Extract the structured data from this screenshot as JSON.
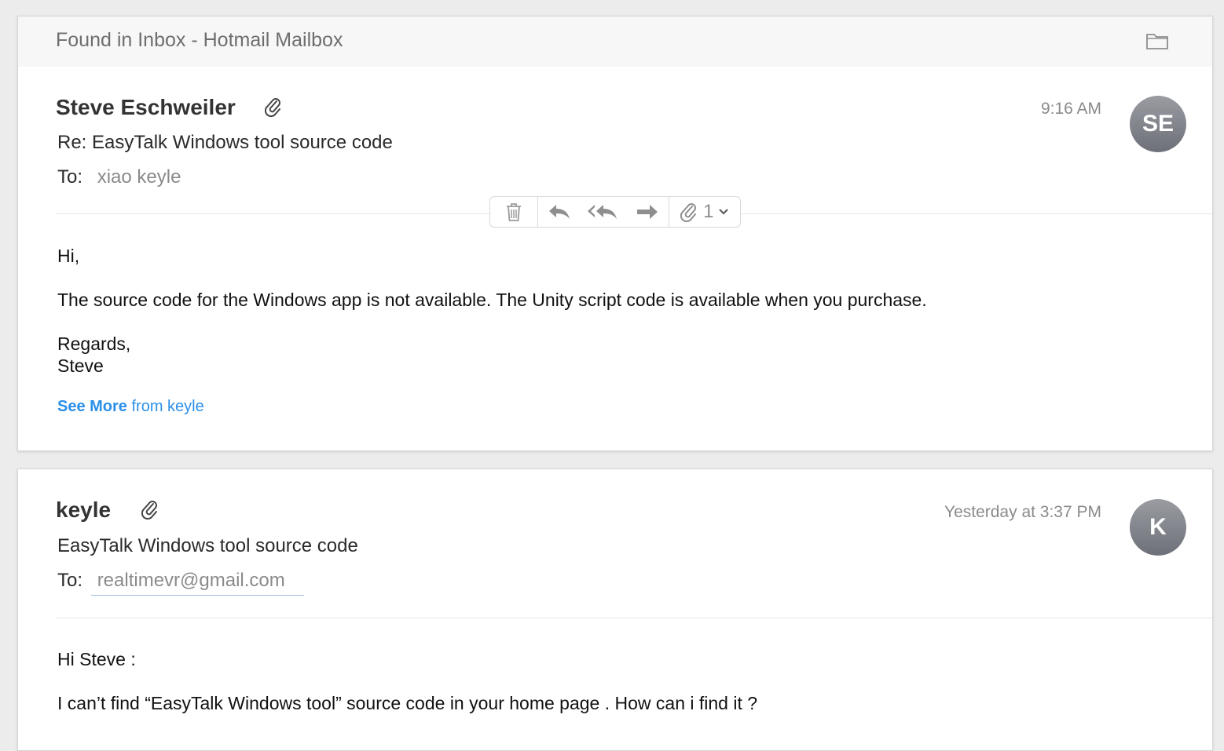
{
  "thread": {
    "found_label": "Found in Inbox - Hotmail Mailbox"
  },
  "messages": [
    {
      "sender": "Steve Eschweiler",
      "time": "9:16 AM",
      "avatar_initials": "SE",
      "subject": "Re: EasyTalk Windows tool source code",
      "to_label": "To:",
      "to": "xiao keyle",
      "toolbar": {
        "attachment_count": "1"
      },
      "body": {
        "greeting": "Hi,",
        "line1": "The source code for the Windows app is not available. The Unity script code is available when you purchase.",
        "regards": "Regards,",
        "signature": "Steve"
      },
      "see_more": {
        "bold": "See More",
        "rest": " from keyle"
      }
    },
    {
      "sender": "keyle",
      "time": "Yesterday at 3:37 PM",
      "avatar_initials": "K",
      "subject": "EasyTalk Windows tool source code",
      "to_label": "To:",
      "to": "realtimevr@gmail.com",
      "body": {
        "greeting": "Hi Steve :",
        "line1": "I can’t find “EasyTalk Windows tool” source code in your home page . How can i find it ?"
      }
    }
  ],
  "colors": {
    "link": "#2b8fe8",
    "avatar": "#7e8189",
    "muted_text": "#8a8a8a"
  }
}
